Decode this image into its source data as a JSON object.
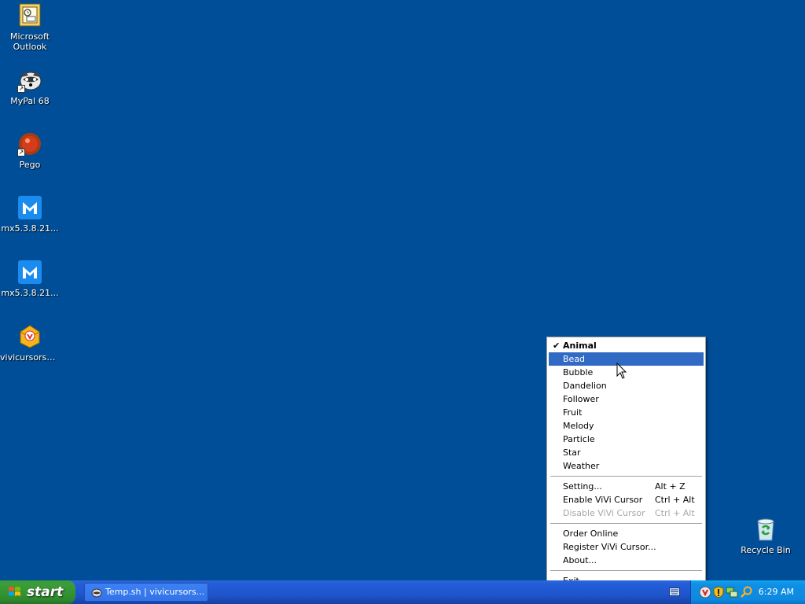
{
  "desktop": {
    "icons": [
      {
        "name": "outlook-icon",
        "label_top": "Microsoft",
        "label_bottom": "Outlook"
      },
      {
        "name": "mypal-icon",
        "label": "MyPal 68"
      },
      {
        "name": "pego-icon",
        "label": "Pego"
      },
      {
        "name": "maxthon-icon",
        "label": "mx5.3.8.21..."
      },
      {
        "name": "maxthon-icon",
        "label": "mx5.3.8.21..."
      },
      {
        "name": "vivicursor-setup-icon",
        "label": "vivicursorsetup"
      },
      {
        "name": "recycle-bin-icon",
        "label": "Recycle Bin"
      }
    ]
  },
  "menu": {
    "themes": [
      {
        "label": "Animal",
        "checked": true,
        "bold": true
      },
      {
        "label": "Bead",
        "highlighted": true
      },
      {
        "label": "Bubble"
      },
      {
        "label": "Dandelion"
      },
      {
        "label": "Follower"
      },
      {
        "label": "Fruit"
      },
      {
        "label": "Melody"
      },
      {
        "label": "Particle"
      },
      {
        "label": "Star"
      },
      {
        "label": "Weather"
      }
    ],
    "settings": [
      {
        "label": "Setting...",
        "shortcut": "Alt + Z"
      },
      {
        "label": "Enable ViVi Cursor",
        "shortcut": "Ctrl + Alt"
      },
      {
        "label": "Disable ViVi Cursor",
        "shortcut": "Ctrl + Alt",
        "disabled": true
      }
    ],
    "links": [
      {
        "label": "Order Online"
      },
      {
        "label": "Register ViVi Cursor..."
      },
      {
        "label": "About..."
      }
    ],
    "exit": {
      "label": "Exit"
    }
  },
  "taskbar": {
    "start_label": "start",
    "task_button_label": "Temp.sh | vivicursors...",
    "clock": "6:29 AM"
  },
  "colors": {
    "desktop": "#004e98",
    "highlight": "#316ac5",
    "taskbar": "#245edb",
    "start": "#3a9d38"
  }
}
